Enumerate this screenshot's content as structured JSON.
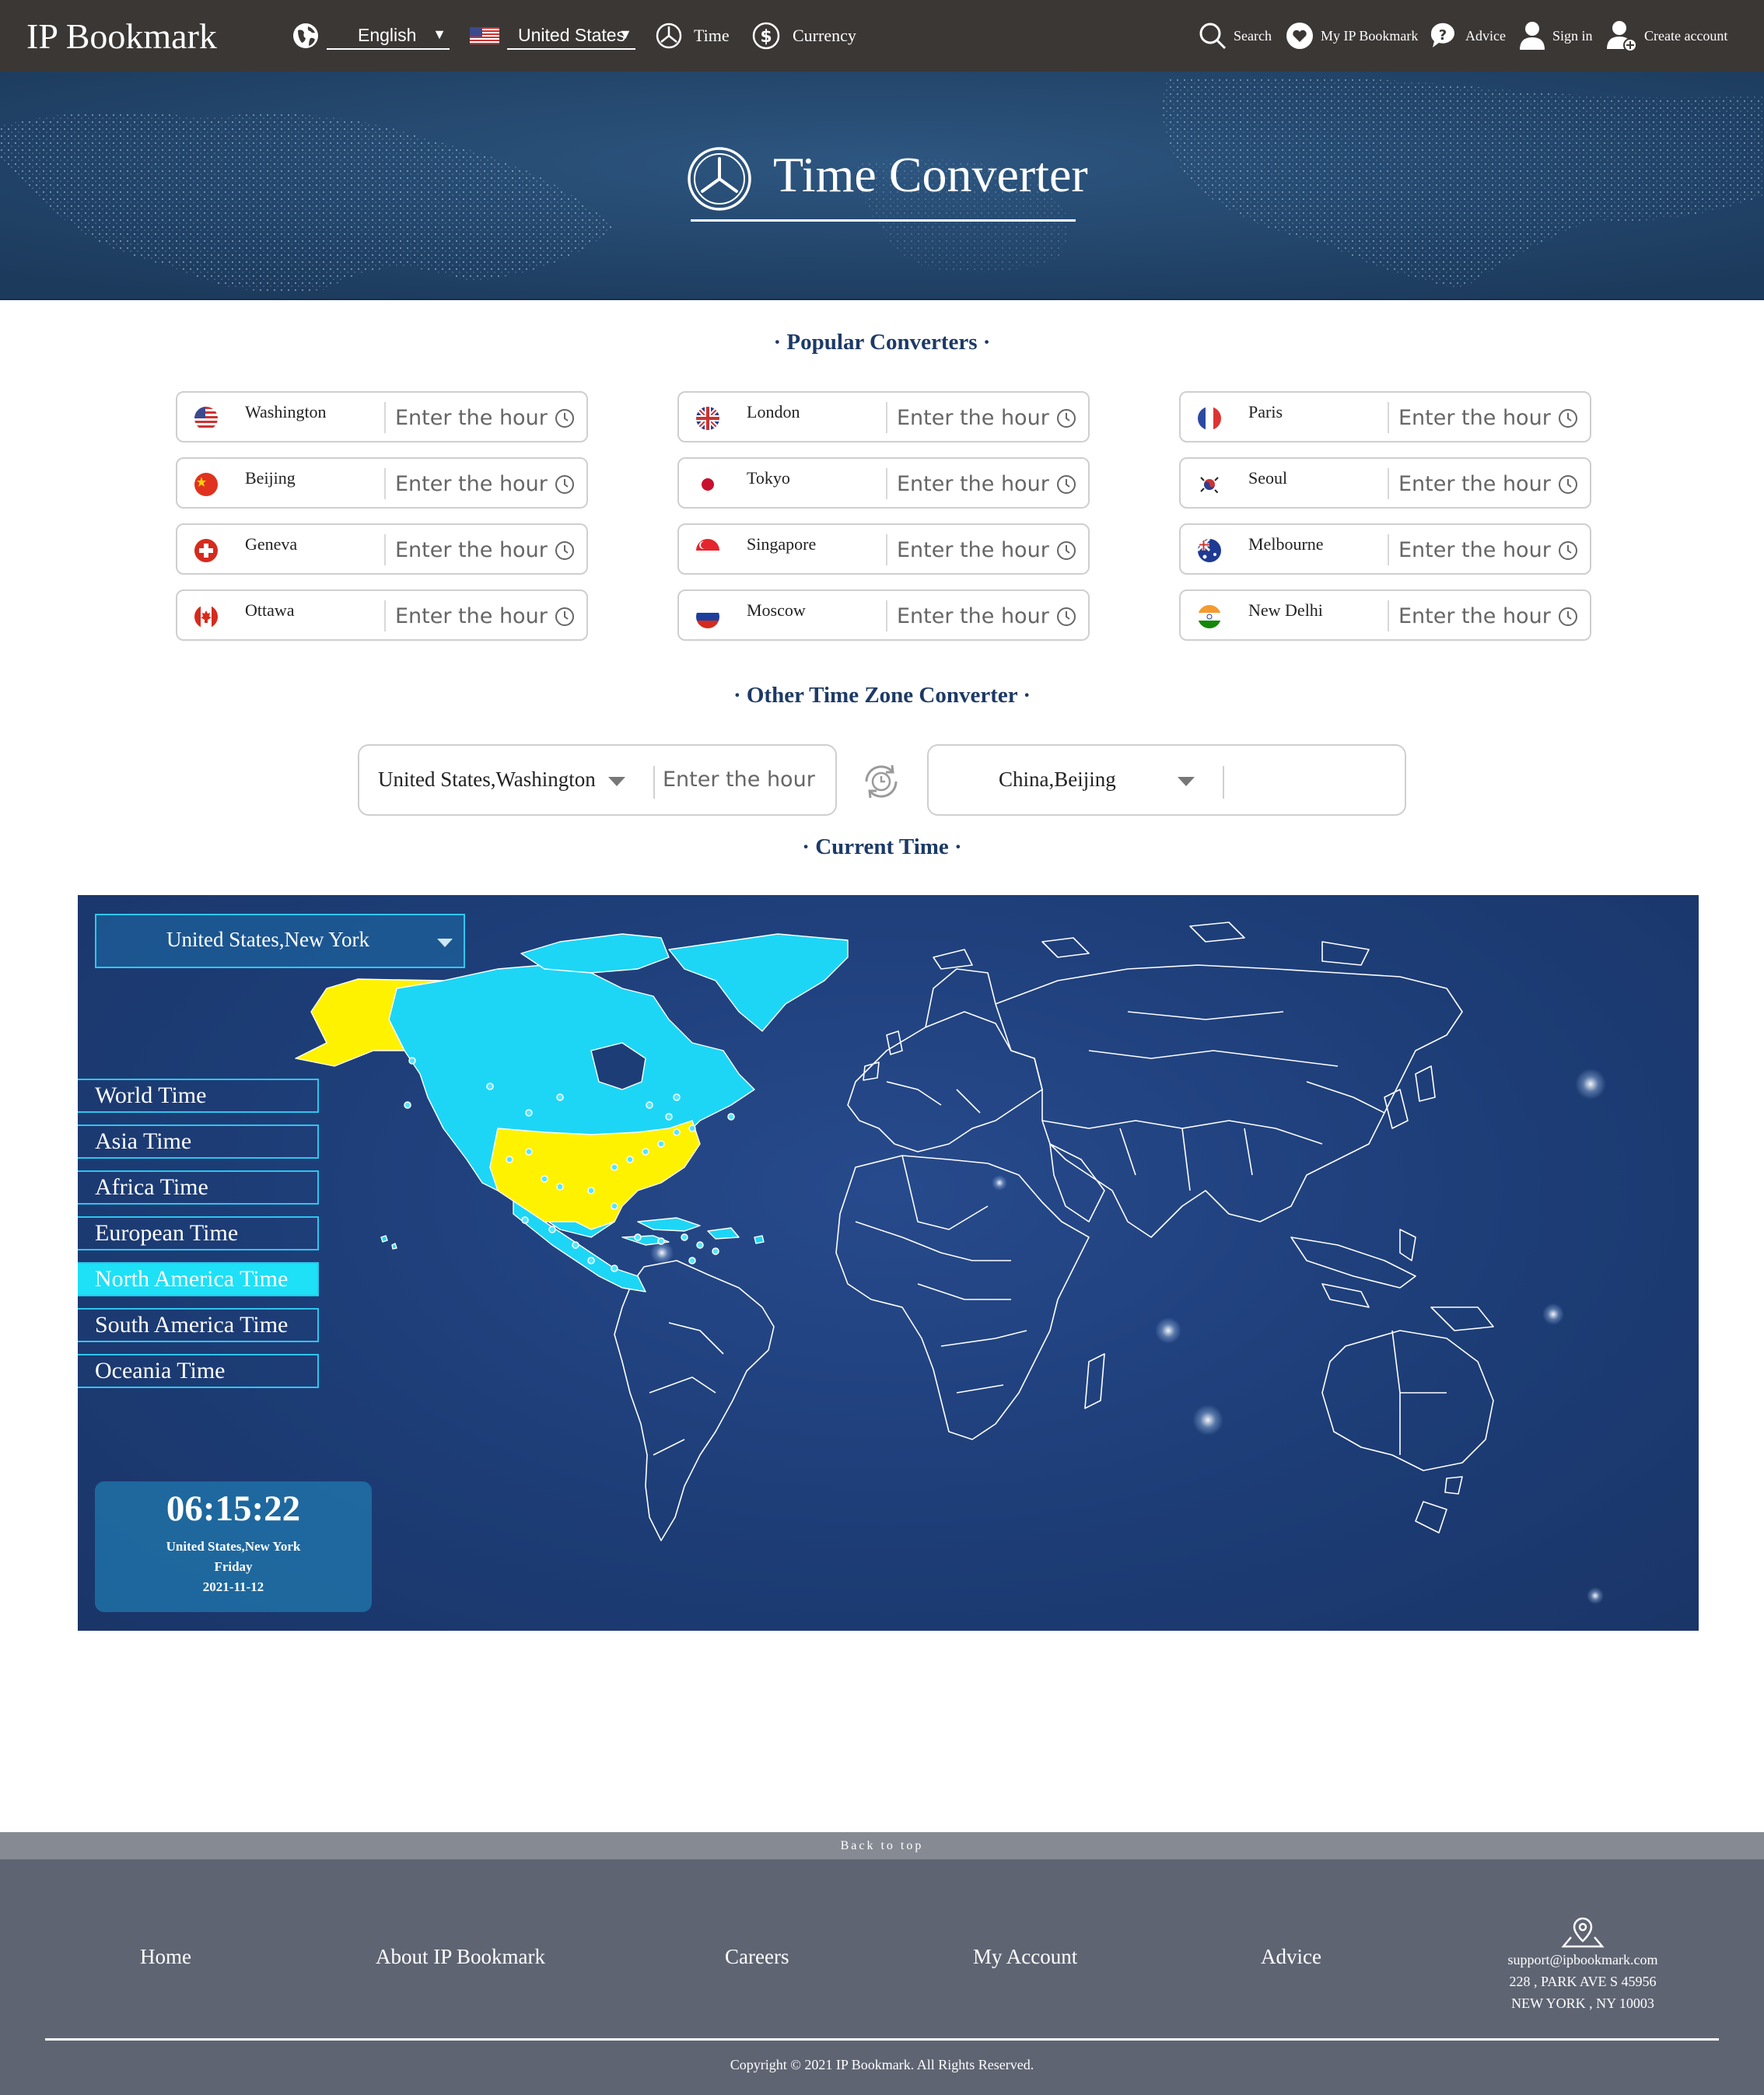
{
  "nav": {
    "logo": "IP Bookmark",
    "language": "English",
    "country": "United States",
    "time_label": "Time",
    "currency_label": "Currency",
    "search_label": "Search",
    "my_bookmark_label": "My IP Bookmark",
    "advice_label": "Advice",
    "signin_label": "Sign in",
    "create_label": "Create account"
  },
  "hero": {
    "title": "Time Converter"
  },
  "popular": {
    "title": "· Popular Converters ·",
    "placeholder": "Enter the hour",
    "cities": [
      {
        "name": "Washington",
        "flag": "us"
      },
      {
        "name": "London",
        "flag": "gb"
      },
      {
        "name": "Paris",
        "flag": "fr"
      },
      {
        "name": "Beijing",
        "flag": "cn"
      },
      {
        "name": "Tokyo",
        "flag": "jp"
      },
      {
        "name": "Seoul",
        "flag": "kr"
      },
      {
        "name": "Geneva",
        "flag": "ch"
      },
      {
        "name": "Singapore",
        "flag": "sg"
      },
      {
        "name": "Melbourne",
        "flag": "au"
      },
      {
        "name": "Ottawa",
        "flag": "ca"
      },
      {
        "name": "Moscow",
        "flag": "ru"
      },
      {
        "name": "New Delhi",
        "flag": "in"
      }
    ]
  },
  "other": {
    "title": "· Other Time Zone Converter ·",
    "from": "United States,Washington",
    "placeholder": "Enter the hour",
    "to": "China,Beijing"
  },
  "current": {
    "title": "· Current Time ·",
    "selected": "United States,New York",
    "regions": [
      "World Time",
      "Asia Time",
      "Africa Time",
      "European Time",
      "North America Time",
      "South America Time",
      "Oceania Time"
    ],
    "active_region": "North America Time",
    "time": "06:15:22",
    "location": "United States,New York",
    "day": "Friday",
    "date": "2021-11-12",
    "colors": {
      "highlight": "#fff200",
      "region": "#1dd6f5",
      "panel": "#1d3d77"
    }
  },
  "footer": {
    "back_to_top": "Back to top",
    "links": [
      "Home",
      "About IP Bookmark",
      "Careers",
      "My Account",
      "Advice"
    ],
    "email": "support@ipbookmark.com",
    "address1": "228 , PARK AVE S 45956",
    "address2": "NEW YORK , NY 10003",
    "copyright": "Copyright © 2021 IP Bookmark. All Rights Reserved."
  }
}
